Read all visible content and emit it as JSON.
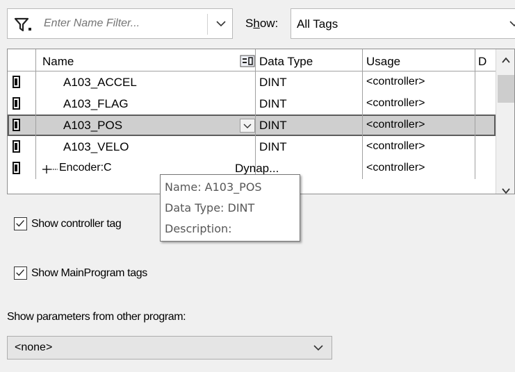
{
  "filter": {
    "placeholder": "Enter Name Filter...",
    "icon": "filter-icon"
  },
  "show": {
    "label": "Show:",
    "selected": "All Tags"
  },
  "grid": {
    "columns": {
      "name": "Name",
      "data_type": "Data Type",
      "usage": "Usage",
      "description": "D"
    },
    "rows": [
      {
        "name": "A103_ACCEL",
        "data_type": "DINT",
        "usage": "<controller>"
      },
      {
        "name": "A103_FLAG",
        "data_type": "DINT",
        "usage": "<controller>"
      },
      {
        "name": "A103_POS",
        "data_type": "DINT",
        "usage": "<controller>",
        "selected": true
      },
      {
        "name": "A103_VELO",
        "data_type": "DINT",
        "usage": "<controller>"
      },
      {
        "name": "Encoder:C",
        "data_type": "Dynap...",
        "usage": "<controller>"
      }
    ]
  },
  "tooltip": {
    "name_line": "Name: A103_POS",
    "type_line": "Data Type: DINT",
    "desc_line": "Description:"
  },
  "options": {
    "controller_tags": {
      "label": "Show controller tag",
      "checked": true
    },
    "mainprogram_tags": {
      "label": "Show MainProgram tags",
      "checked": true
    },
    "params_label": "Show parameters from other program:",
    "params_selected": "<none>"
  },
  "colors": {
    "selected_row": "#cfcfcf",
    "grid_border": "#8e8e8e"
  }
}
